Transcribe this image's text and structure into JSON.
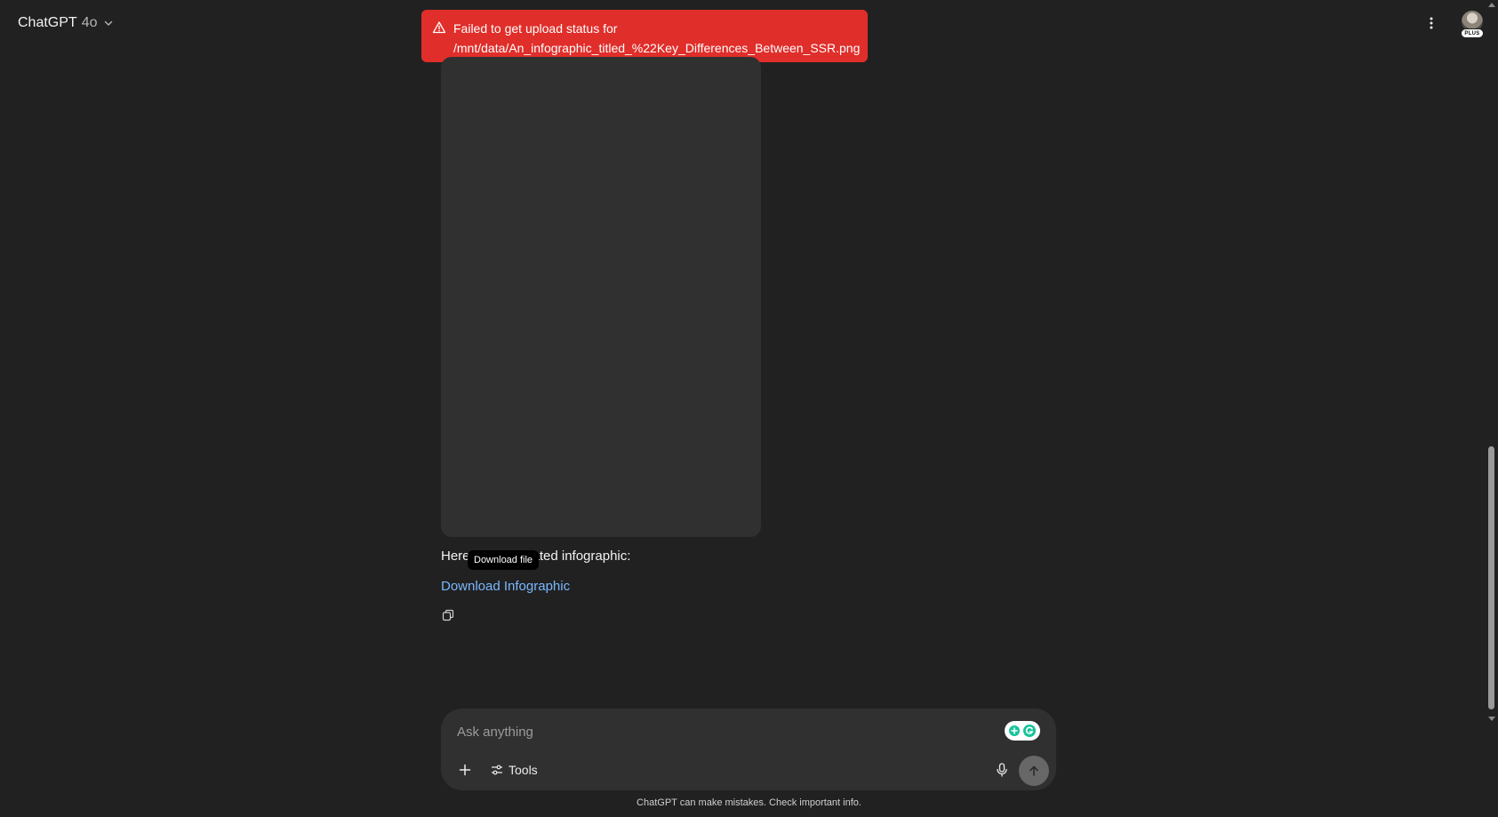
{
  "header": {
    "brand": "ChatGPT",
    "model": "4o",
    "badge": "PLUS"
  },
  "toast": {
    "line1": "Failed to get upload status for",
    "line2": "/mnt/data/An_infographic_titled_%22Key_Differences_Between_SSR.png",
    "color": "#e02e2a"
  },
  "message": {
    "text_before": "Here",
    "text_after": "ated infographic:",
    "tooltip": "Download file",
    "link": "Download Infographic"
  },
  "composer": {
    "placeholder": "Ask anything",
    "tools_label": "Tools"
  },
  "footer": {
    "disclaimer": "ChatGPT can make mistakes. Check important info."
  },
  "scrollbar": {
    "position_fraction": 0.62
  },
  "icons": {
    "model_chevron": "chevron-down-icon",
    "more": "more-vertical-icon",
    "warning": "warning-triangle-icon",
    "copy": "copy-icon",
    "add": "plus-icon",
    "tools": "sliders-icon",
    "mic": "microphone-icon",
    "send": "arrow-up-icon"
  }
}
